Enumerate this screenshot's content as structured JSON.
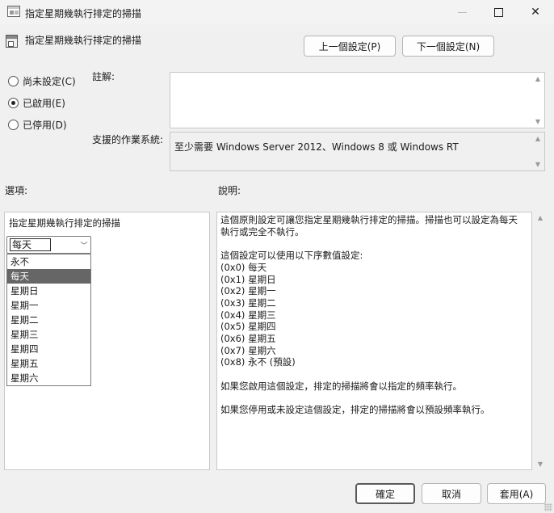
{
  "window": {
    "title": "指定星期幾執行排定的掃描",
    "controls": {
      "minimize": "minimize",
      "maximize": "maximize",
      "close": "✕"
    }
  },
  "header": {
    "title": "指定星期幾執行排定的掃描",
    "prev_button": "上一個設定(P)",
    "next_button": "下一個設定(N)"
  },
  "state": {
    "options": [
      {
        "label": "尚未設定(C)",
        "checked": false
      },
      {
        "label": "已啟用(E)",
        "checked": true
      },
      {
        "label": "已停用(D)",
        "checked": false
      }
    ]
  },
  "comment": {
    "label": "註解:",
    "value": ""
  },
  "supported": {
    "label": "支援的作業系統:",
    "value": "至少需要 Windows Server 2012、Windows 8 或 Windows RT"
  },
  "options_section": {
    "label": "選項:",
    "field_label": "指定星期幾執行排定的掃描",
    "combo_value": "每天",
    "dropdown_items": [
      "永不",
      "每天",
      "星期日",
      "星期一",
      "星期二",
      "星期三",
      "星期四",
      "星期五",
      "星期六"
    ],
    "selected_index": 1
  },
  "help_section": {
    "label": "說明:",
    "text": "這個原則設定可讓您指定星期幾執行排定的掃描。掃描也可以設定為每天執行或完全不執行。\n\n這個設定可以使用以下序數值設定:\n(0x0) 每天\n(0x1) 星期日\n(0x2) 星期一\n(0x3) 星期二\n(0x4) 星期三\n(0x5) 星期四\n(0x6) 星期五\n(0x7) 星期六\n(0x8) 永不 (預設)\n\n如果您啟用這個設定，排定的掃描將會以指定的頻率執行。\n\n如果您停用或未設定這個設定，排定的掃描將會以預設頻率執行。"
  },
  "footer": {
    "ok": "確定",
    "cancel": "取消",
    "apply": "套用(A)"
  }
}
